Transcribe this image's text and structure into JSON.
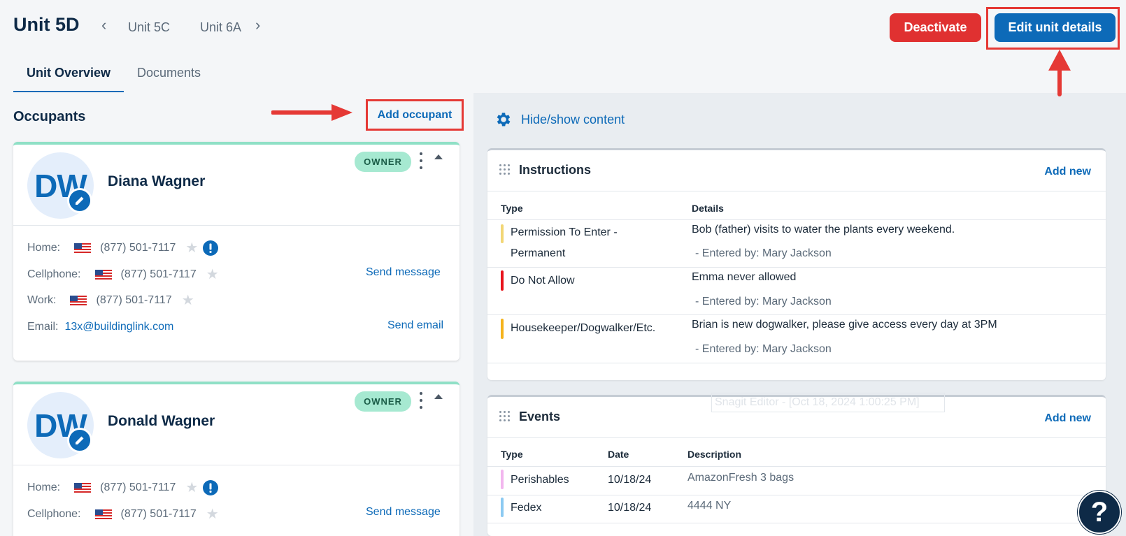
{
  "header": {
    "unit_title": "Unit 5D",
    "prev_unit": "Unit 5C",
    "next_unit": "Unit 6A",
    "deactivate_label": "Deactivate",
    "edit_label": "Edit unit details"
  },
  "tabs": [
    {
      "label": "Unit Overview",
      "active": true
    },
    {
      "label": "Documents",
      "active": false
    }
  ],
  "occupants": {
    "heading": "Occupants",
    "add_label": "Add occupant",
    "items": [
      {
        "initials": "DW",
        "name": "Diana Wagner",
        "role": "OWNER",
        "home_label": "Home:",
        "home_phone": "(877) 501-7117",
        "cell_label": "Cellphone:",
        "cell_phone": "(877) 501-7117",
        "work_label": "Work:",
        "work_phone": "(877) 501-7117",
        "email_label": "Email:",
        "email": "13x@buildinglink.com",
        "send_message": "Send message",
        "send_email": "Send email"
      },
      {
        "initials": "DW",
        "name": "Donald Wagner",
        "role": "OWNER",
        "home_label": "Home:",
        "home_phone": "(877) 501-7117",
        "cell_label": "Cellphone:",
        "cell_phone": "(877) 501-7117",
        "send_message": "Send message"
      }
    ]
  },
  "content": {
    "hide_show_label": "Hide/show content"
  },
  "instructions": {
    "title": "Instructions",
    "add_label": "Add new",
    "col_type": "Type",
    "col_details": "Details",
    "rows": [
      {
        "type_line1": "Permission To Enter -",
        "type_line2": "Permanent",
        "details": "Bob (father) visits to water the plants every weekend.",
        "entered_by": "- Entered by: Mary Jackson",
        "color": "#f2d675"
      },
      {
        "type_line1": "Do Not Allow",
        "type_line2": "",
        "details": "Emma never allowed",
        "entered_by": "- Entered by: Mary Jackson",
        "color": "#e8141c"
      },
      {
        "type_line1": "Housekeeper/Dogwalker/Etc.",
        "type_line2": "",
        "details": "Brian is new dogwalker, please give access every day at 3PM",
        "entered_by": "- Entered by: Mary Jackson",
        "color": "#f5b31c"
      }
    ]
  },
  "events": {
    "title": "Events",
    "add_label": "Add new",
    "col_type": "Type",
    "col_date": "Date",
    "col_desc": "Description",
    "rows": [
      {
        "type": "Perishables",
        "date": "10/18/24",
        "description": "AmazonFresh 3 bags",
        "color": "#f2b6ee"
      },
      {
        "type": "Fedex",
        "date": "10/18/24",
        "description": "4444 NY",
        "color": "#8ccaf2"
      }
    ]
  },
  "watermark": "Snagit Editor - [Oct 18, 2024 1:00:25 PM]",
  "help_label": "?"
}
